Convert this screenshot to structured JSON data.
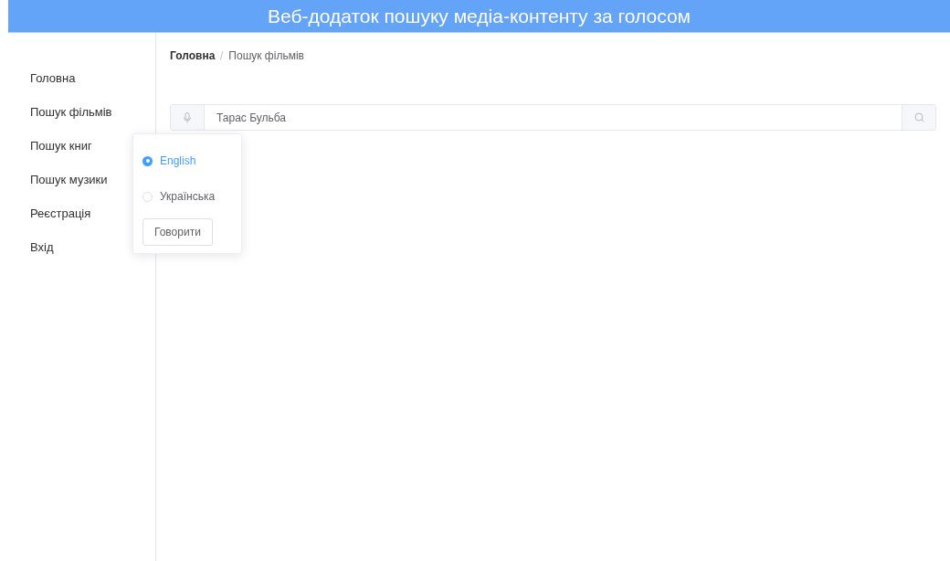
{
  "header": {
    "title": "Веб-додаток пошуку медіа-контенту за голосом"
  },
  "sidebar": {
    "items": [
      {
        "label": "Головна"
      },
      {
        "label": "Пошук фільмів"
      },
      {
        "label": "Пошук книг"
      },
      {
        "label": "Пошук музики"
      },
      {
        "label": "Реєстрація"
      },
      {
        "label": "Вхід"
      }
    ]
  },
  "breadcrumb": [
    "Головна",
    "Пошук фільмів"
  ],
  "search": {
    "value": "Тарас Бульба"
  },
  "popover": {
    "options": [
      {
        "label": "English",
        "selected": true
      },
      {
        "label": "Українська",
        "selected": false
      }
    ],
    "button": "Говорити"
  }
}
